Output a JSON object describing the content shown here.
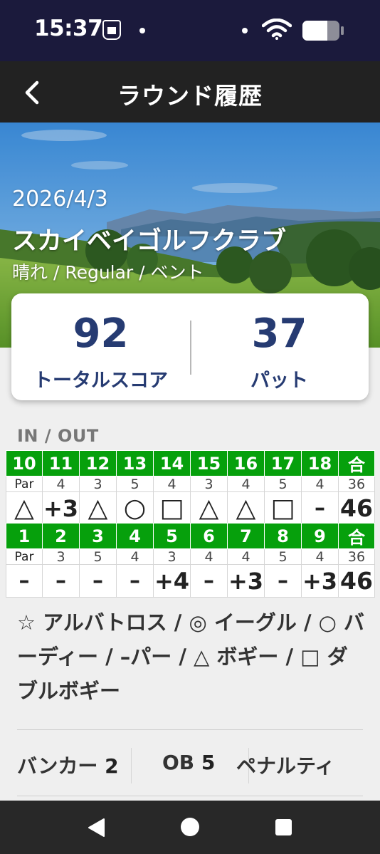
{
  "status_bar": {
    "time": "15:37",
    "icons": [
      "app-notification-icon",
      "dot-icon",
      "dot-icon",
      "wifi-icon",
      "battery-icon"
    ]
  },
  "header": {
    "title": "ラウンド履歴",
    "back_icon": "chevron-left-icon"
  },
  "round": {
    "date": "2026/4/3",
    "course": "スカイベイゴルフクラブ",
    "meta": "晴れ / Regular / ベント"
  },
  "summary": {
    "total_score": "92",
    "total_score_label": "トータルスコア",
    "putts": "37",
    "putts_label": "パット"
  },
  "scorecard": {
    "section_label": "IN / OUT",
    "par_label": "Par",
    "total_header": "合",
    "in": {
      "holes": [
        "10",
        "11",
        "12",
        "13",
        "14",
        "15",
        "16",
        "17",
        "18"
      ],
      "pars": [
        "4",
        "3",
        "5",
        "4",
        "3",
        "4",
        "5",
        "4"
      ],
      "pars_full": [
        "4",
        "3",
        "5",
        "4",
        "3",
        "4",
        "5",
        "4"
      ],
      "scores": [
        "△",
        "+3",
        "△",
        "○",
        "□",
        "△",
        "△",
        "□",
        "–"
      ],
      "par_total": "36",
      "score_total": "46"
    },
    "out": {
      "holes": [
        "1",
        "2",
        "3",
        "4",
        "5",
        "6",
        "7",
        "8",
        "9"
      ],
      "pars": [
        "3",
        "5",
        "4",
        "3",
        "4",
        "4",
        "5",
        "4"
      ],
      "scores": [
        "–",
        "–",
        "–",
        "–",
        "+4",
        "–",
        "+3",
        "–",
        "+3"
      ],
      "par_total": "36",
      "score_total": "46"
    }
  },
  "legend": "☆ アルバトロス / ◎ イーグル / ○ バーディー / –パー / △ ボギー / □ ダブルボギー",
  "stats": [
    {
      "label": "バンカー",
      "value": "2"
    },
    {
      "label": "OB",
      "value": "5"
    },
    {
      "label": "ペナルティ",
      "value": ""
    }
  ],
  "colors": {
    "header_bg": "#222222",
    "status_bg": "#1b1a3c",
    "hole_row_green": "#06a00c",
    "summary_text": "#263b72"
  },
  "nav_bar": {
    "icons": [
      "back-triangle-icon",
      "home-circle-icon",
      "recents-square-icon"
    ]
  }
}
